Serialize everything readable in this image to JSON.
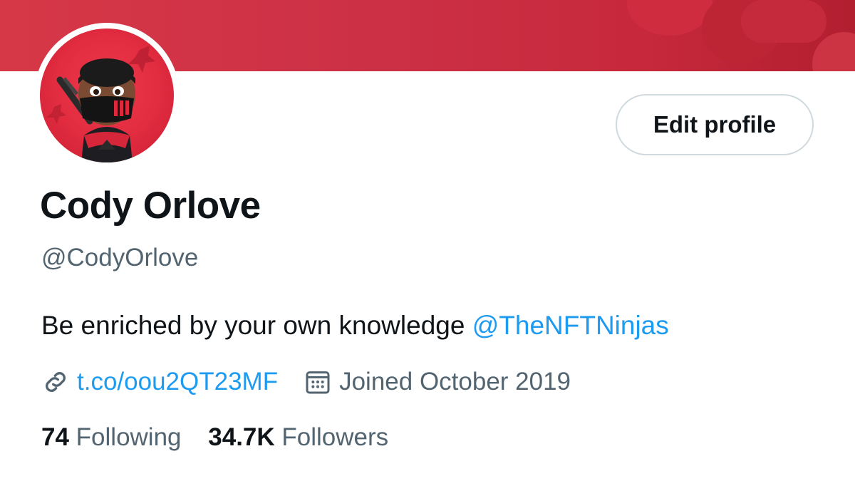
{
  "profile": {
    "display_name": "Cody Orlove",
    "handle": "@CodyOrlove",
    "bio_text": "Be enriched by your own knowledge ",
    "bio_mention": "@TheNFTNinjas",
    "website": "t.co/oou2QT23MF",
    "joined": "Joined October 2019",
    "edit_button_label": "Edit profile"
  },
  "stats": {
    "following_count": "74",
    "following_label": "Following",
    "followers_count": "34.7K",
    "followers_label": "Followers"
  },
  "icons": {
    "website": "link-icon",
    "joined": "calendar-icon"
  },
  "colors": {
    "banner": "#cc3045",
    "accent": "#1d9bf0",
    "secondary_text": "#536471",
    "primary_text": "#0f1419"
  }
}
